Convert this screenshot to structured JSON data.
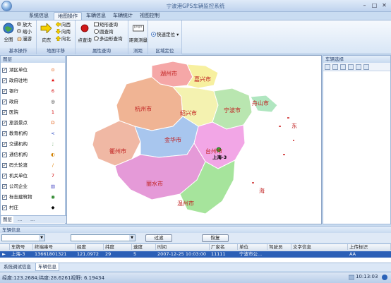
{
  "window": {
    "title": "宁波港GPS车辆监控系统"
  },
  "menu_tabs": [
    {
      "label": "系统信息"
    },
    {
      "label": "地图操作"
    },
    {
      "label": "车辆信息"
    },
    {
      "label": "车辆统计"
    },
    {
      "label": "视图控制"
    }
  ],
  "active_tab": "地图操作",
  "ribbon": {
    "basic": {
      "caption": "基本操作",
      "full_map": "全图",
      "zoom_in": "放大",
      "zoom_out": "缩小",
      "pan": "漫游"
    },
    "pan_group": {
      "caption": "地图平移",
      "east": "向东",
      "west": "向西",
      "south": "向南",
      "north": "向北"
    },
    "attr_query": {
      "caption": "属性查询",
      "point_query": "点查询",
      "rect_query": "矩形查询",
      "circle_query": "圆查询",
      "polygon_query": "多边形查询"
    },
    "measure": {
      "caption": "测距",
      "distance": "距离测量"
    },
    "area_locate": {
      "caption": "区域定位",
      "quick_locate": "快速定位"
    }
  },
  "left_panel": {
    "title": "图层",
    "layers": [
      {
        "name": "湖区单位",
        "checked": true,
        "symbol": "⊙",
        "color": "#e05000"
      },
      {
        "name": "政府驻地",
        "checked": true,
        "symbol": "★",
        "color": "#e00000"
      },
      {
        "name": "银行",
        "checked": true,
        "symbol": "6",
        "color": "#d00000"
      },
      {
        "name": "政府",
        "checked": true,
        "symbol": "◎",
        "color": "#222222"
      },
      {
        "name": "医院",
        "checked": true,
        "symbol": "1",
        "color": "#d00000"
      },
      {
        "name": "旅游景点",
        "checked": true,
        "symbol": "D",
        "color": "#e05000"
      },
      {
        "name": "教育机构",
        "checked": true,
        "symbol": "<",
        "color": "#2040c0"
      },
      {
        "name": "交通机构",
        "checked": true,
        "symbol": ";",
        "color": "#208020"
      },
      {
        "name": "通信机构",
        "checked": true,
        "symbol": "◐",
        "color": "#d08000"
      },
      {
        "name": "码头轮渡",
        "checked": true,
        "symbol": "/",
        "color": "#e08000"
      },
      {
        "name": "机关单位",
        "checked": true,
        "symbol": "7",
        "color": "#d00000"
      },
      {
        "name": "公司企业",
        "checked": true,
        "symbol": "▥",
        "color": "#4040c0"
      },
      {
        "name": "标志建筑物",
        "checked": true,
        "symbol": "◉",
        "color": "#208020"
      },
      {
        "name": "村庄",
        "checked": true,
        "symbol": "◆",
        "color": "#000000"
      }
    ],
    "tabs": [
      {
        "label": "图层"
      },
      {
        "label": "..."
      },
      {
        "label": "..."
      }
    ]
  },
  "map": {
    "cities": [
      {
        "name": "湖州市"
      },
      {
        "name": "嘉兴市"
      },
      {
        "name": "杭州市"
      },
      {
        "name": "绍兴市"
      },
      {
        "name": "宁波市"
      },
      {
        "name": "舟山市"
      },
      {
        "name": "衢州市"
      },
      {
        "name": "金华市"
      },
      {
        "name": "台州市"
      },
      {
        "name": "丽水市"
      },
      {
        "name": "温州市"
      }
    ],
    "sea_labels": [
      {
        "name": "东"
      },
      {
        "name": "海"
      }
    ],
    "vehicle_label": "上海-3"
  },
  "right_panel": {
    "title": "车辆选择"
  },
  "vehicle_info": {
    "title": "车辆信息",
    "filter_button": "过滤",
    "restore_button": "恢复",
    "columns": [
      "车牌号",
      "终端串号",
      "经度",
      "纬度",
      "速度",
      "时间",
      "厂家名",
      "单位",
      "驾驶员",
      "文字信息",
      "上传标识"
    ],
    "rows": [
      [
        "上海-3",
        "13661801321",
        "121.0972",
        "29",
        "5",
        "2007-12-25 10:03:00",
        "11111",
        "宁波市公...",
        "",
        "",
        "AA"
      ]
    ]
  },
  "bottom_tabs": [
    {
      "label": "系统调试信息"
    },
    {
      "label": "车辆信息"
    }
  ],
  "active_bottom_tab": "车辆信息",
  "status": {
    "coords": "经度:123.2684;纬度:28.6261视野: 6.19434",
    "time": "10:13:03"
  }
}
